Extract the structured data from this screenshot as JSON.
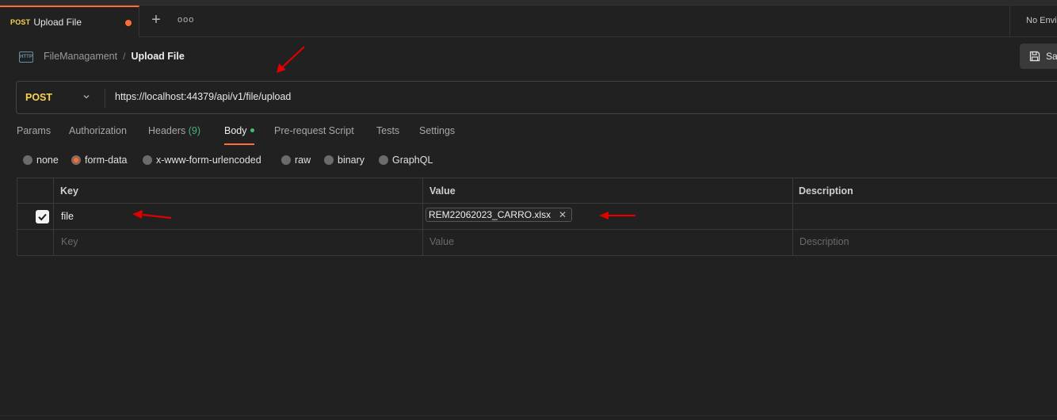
{
  "tab": {
    "method": "POST",
    "title": "Upload File"
  },
  "tabbar": {
    "new_tab": "+",
    "more": "ooo"
  },
  "environment": {
    "label": "No Envi"
  },
  "breadcrumb": {
    "icon_label": "HTTP",
    "parent": "FileManagament",
    "separator": "/",
    "current": "Upload File"
  },
  "save": {
    "label": "Sa"
  },
  "request": {
    "method": "POST",
    "url": "https://localhost:44379/api/v1/file/upload"
  },
  "request_tabs": [
    {
      "label": "Params"
    },
    {
      "label": "Authorization"
    },
    {
      "label": "Headers",
      "count": "(9)"
    },
    {
      "label": "Body"
    },
    {
      "label": "Pre-request Script"
    },
    {
      "label": "Tests"
    },
    {
      "label": "Settings"
    }
  ],
  "body_types": [
    "none",
    "form-data",
    "x-www-form-urlencoded",
    "raw",
    "binary",
    "GraphQL"
  ],
  "body_type_selected": "form-data",
  "table": {
    "headers": {
      "key": "Key",
      "value": "Value",
      "description": "Description"
    },
    "rows": [
      {
        "checked": true,
        "key": "file",
        "value": "REM22062023_CARRO.xlsx",
        "description": ""
      }
    ],
    "placeholders": {
      "key": "Key",
      "value": "Value",
      "description": "Description"
    }
  },
  "colors": {
    "accent": "#ff6c37",
    "method": "#fcd34d",
    "annotation_arrow": "#e00000"
  }
}
